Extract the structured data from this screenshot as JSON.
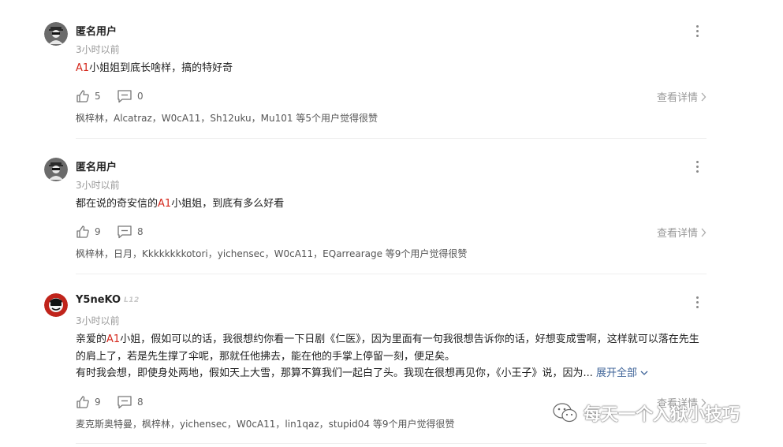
{
  "comments": [
    {
      "username": "匿名用户",
      "avatar": "anonymous-avatar",
      "time": "3小时以前",
      "content": {
        "hl": "A1",
        "text": "小姐姐到底长啥样，搞的特好奇"
      },
      "likes": "5",
      "replies": "0",
      "detail_label": "查看详情",
      "likers_text": "枫梓林，Alcatraz，W0cA11，Sh12uku，Mu101 等5个用户觉得很赞"
    },
    {
      "username": "匿名用户",
      "avatar": "anonymous-avatar",
      "time": "3小时以前",
      "content": {
        "pre": "都在说的奇安信的",
        "hl": "A1",
        "post": "小姐姐，到底有多么好看"
      },
      "likes": "9",
      "replies": "8",
      "detail_label": "查看详情",
      "likers_text": "枫梓林，日月，Kkkkkkkkotori，yichensec，W0cA11，EQarrearage 等9个用户觉得很赞"
    },
    {
      "username": "Y5neKO",
      "level": "L12",
      "avatar": "red-avatar",
      "time": "3小时以前",
      "content": {
        "pre": "亲爱的",
        "hl": "A1",
        "post": "小姐，假如可以的话，我很想约你看一下日剧《仁医》，因为里面有一句我很想告诉你的话，好想变成雪啊，这样就可以落在先生的肩上了，若是先生撑了伞呢，那就任他拂去，能在他的手掌上停留一刻，便足矣。",
        "line2": "有时我会想，即使身处两地，假如天上大雪，那算不算我们一起白了头。我现在很想再见你，《小王子》说，因为...",
        "expand": "展开全部"
      },
      "likes": "9",
      "replies": "8",
      "detail_label": "查看详情",
      "likers_text": "麦克斯奥特曼，枫梓林，yichensec，W0cA11，lin1qaz，stupid04 等9个用户觉得很赞"
    }
  ],
  "watermark": {
    "text": "每天一个入狱小技巧",
    "icon": "wechat-icon"
  },
  "colors": {
    "highlight": "#d4281c",
    "muted": "#999999",
    "link": "#406599"
  }
}
